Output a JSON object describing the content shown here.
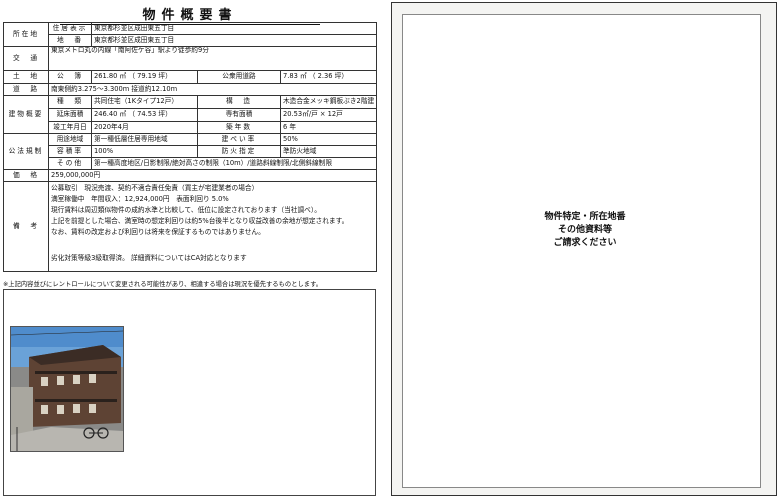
{
  "title": "物件概要書",
  "rows": {
    "location_label": "所在地",
    "address_label": "住居表示",
    "address_value": "東京都杉並区成田東五丁目",
    "lot_label": "地　番",
    "lot_value": "東京都杉並区成田東五丁目",
    "traffic_label": "交　通",
    "traffic_value": "東京メトロ丸の内線「南阿佐ケ谷」駅より徒歩約9分",
    "land_label": "土　地",
    "public_label": "公　簿",
    "public_value": "261.80 ㎡ （ 79.19 坪）",
    "public_road_label": "公衆用道路",
    "public_road_value": "7.83 ㎡ （ 2.36 坪）",
    "road_label": "道　路",
    "road_value": "南東側約3.275～3.300m 接道約12.10m",
    "building_label": "建物概要",
    "type_label": "種　類",
    "type_value": "共同住宅（1Kタイプ12戸）",
    "structure_label": "構　造",
    "structure_value": "木造合金メッキ鋼板ぶき2階建",
    "floor_label": "延床面積",
    "floor_value": "246.40 ㎡ （ 74.53 坪）",
    "private_label": "専有面積",
    "private_value": "20.53㎡/戸 × 12戸",
    "completed_label": "竣工年月日",
    "completed_value": "2020年4月",
    "age_label": "築年数",
    "age_value": "6 年",
    "regulation_label": "公法規制",
    "use_label": "用途地域",
    "use_value": "第一種低層住居専用地域",
    "bcr_label": "建ぺい率",
    "bcr_value": "50%",
    "far_label": "容積率",
    "far_value": "100%",
    "fire_label": "防火指定",
    "fire_value": "準防火地域",
    "other_label": "その他",
    "other_value": "第一種高度地区/日影制限/絶対高さの制限（10m）/道路斜線制限/北側斜線制限",
    "price_label": "価　格",
    "price_value": "259,000,000円",
    "remarks_label": "備　考",
    "remarks_lines": [
      "公募取引　現況売渡、契約不適合責任免責（買主が宅建業者の場合）",
      "満室稼働中　年間収入：12,924,000円　表面利回り 5.0%",
      "現行賃料は周辺類似物件の成約水準と比較して、低位に設定されております（当社調べ）。",
      "上記を前提とした場合、満室時の想定利回りは約5%台後半となり収益改善の余地が想定されます。",
      "なお、賃料の改定および利回りは将来を保証するものではありません。",
      "",
      "",
      "劣化対策等級3級取得済。 詳細資料についてはCA対応となります"
    ]
  },
  "footnote": "※上記内容並びにレントロールについて変更される可能性があり、相違する場合は現況を優先するものとします。",
  "right_panel": {
    "lines": [
      "物件特定・所在地番",
      "その他資料等",
      "ご請求ください"
    ]
  }
}
